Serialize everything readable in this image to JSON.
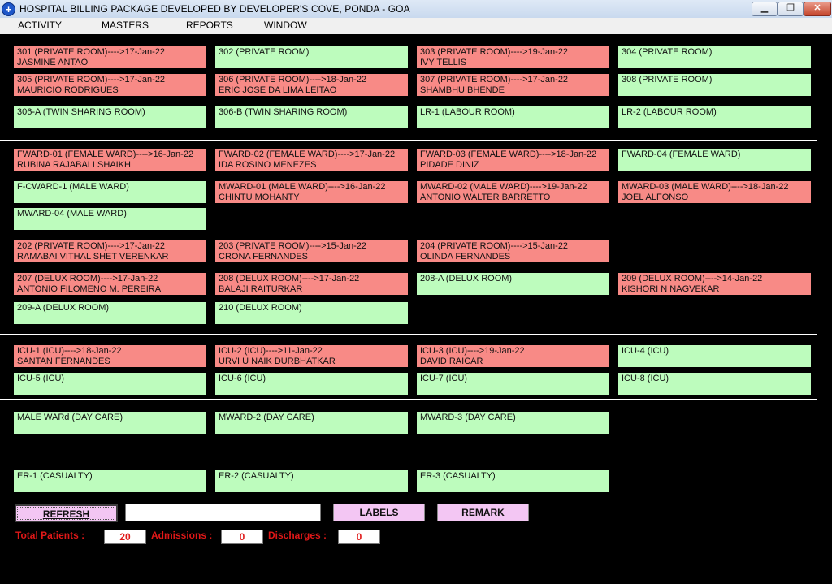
{
  "window": {
    "title": "HOSPITAL BILLING PACKAGE DEVELOPED BY DEVELOPER'S COVE, PONDA - GOA",
    "app_icon": "plus-icon",
    "controls": {
      "minimize": "▁",
      "restore": "❐",
      "close": "✕"
    }
  },
  "menu": [
    "ACTIVITY",
    "MASTERS",
    "REPORTS",
    "WINDOW"
  ],
  "colors": {
    "occupied": "#f88a86",
    "available": "#bdfcbd",
    "stat_text": "#e01818",
    "button": "#f3c6f3"
  },
  "beds": [
    {
      "l1": "301 (PRIVATE ROOM)---->17-Jan-22",
      "l2": "JASMINE ANTAO",
      "occ": true
    },
    {
      "l1": "302 (PRIVATE ROOM)",
      "l2": "",
      "occ": false
    },
    {
      "l1": "303 (PRIVATE ROOM)---->19-Jan-22",
      "l2": "IVY TELLIS",
      "occ": true
    },
    {
      "l1": "304 (PRIVATE ROOM)",
      "l2": "",
      "occ": false
    },
    {
      "l1": "305 (PRIVATE ROOM)---->17-Jan-22",
      "l2": "MAURICIO RODRIGUES",
      "occ": true
    },
    {
      "l1": "306 (PRIVATE ROOM)---->18-Jan-22",
      "l2": "ERIC JOSE DA LIMA LEITAO",
      "occ": true
    },
    {
      "l1": "307 (PRIVATE ROOM)---->17-Jan-22",
      "l2": "SHAMBHU BHENDE",
      "occ": true
    },
    {
      "l1": "308 (PRIVATE ROOM)",
      "l2": "",
      "occ": false
    },
    {
      "l1": "306-A (TWIN SHARING ROOM)",
      "l2": "",
      "occ": false
    },
    {
      "l1": "306-B (TWIN SHARING ROOM)",
      "l2": "",
      "occ": false
    },
    {
      "l1": "LR-1 (LABOUR ROOM)",
      "l2": "",
      "occ": false
    },
    {
      "l1": "LR-2 (LABOUR ROOM)",
      "l2": "",
      "occ": false
    },
    {
      "l1": "FWARD-01 (FEMALE WARD)---->16-Jan-22",
      "l2": "RUBINA RAJABALI SHAIKH",
      "occ": true
    },
    {
      "l1": "FWARD-02 (FEMALE WARD)---->17-Jan-22",
      "l2": "IDA ROSINO MENEZES",
      "occ": true
    },
    {
      "l1": "FWARD-03 (FEMALE WARD)---->18-Jan-22",
      "l2": "PIDADE DINIZ",
      "occ": true
    },
    {
      "l1": "FWARD-04 (FEMALE WARD)",
      "l2": "",
      "occ": false
    },
    {
      "l1": "F-CWARD-1  (MALE WARD)",
      "l2": "",
      "occ": false
    },
    {
      "l1": "MWARD-01 (MALE WARD)---->16-Jan-22",
      "l2": "CHINTU MOHANTY",
      "occ": true
    },
    {
      "l1": "MWARD-02 (MALE WARD)---->19-Jan-22",
      "l2": "ANTONIO WALTER BARRETTO",
      "occ": true
    },
    {
      "l1": "MWARD-03 (MALE WARD)---->18-Jan-22",
      "l2": "JOEL ALFONSO",
      "occ": true
    },
    {
      "l1": "MWARD-04 (MALE WARD)",
      "l2": "",
      "occ": false
    },
    {
      "l1": "202 (PRIVATE ROOM)---->17-Jan-22",
      "l2": "RAMABAI VITHAL SHET VERENKAR",
      "occ": true
    },
    {
      "l1": "203 (PRIVATE ROOM)---->15-Jan-22",
      "l2": "CRONA FERNANDES",
      "occ": true
    },
    {
      "l1": "204 (PRIVATE ROOM)---->15-Jan-22",
      "l2": "OLINDA FERNANDES",
      "occ": true
    },
    {
      "l1": "207 (DELUX ROOM)---->17-Jan-22",
      "l2": "ANTONIO FILOMENO M. PEREIRA",
      "occ": true
    },
    {
      "l1": "208 (DELUX ROOM)---->17-Jan-22",
      "l2": "BALAJI RAITURKAR",
      "occ": true
    },
    {
      "l1": "208-A (DELUX ROOM)",
      "l2": "",
      "occ": false
    },
    {
      "l1": "209 (DELUX ROOM)---->14-Jan-22",
      "l2": "KISHORI N NAGVEKAR",
      "occ": true
    },
    {
      "l1": "209-A (DELUX ROOM)",
      "l2": "",
      "occ": false
    },
    {
      "l1": "210 (DELUX ROOM)",
      "l2": "",
      "occ": false
    },
    {
      "l1": "ICU-1 (ICU)---->18-Jan-22",
      "l2": "SANTAN FERNANDES",
      "occ": true
    },
    {
      "l1": "ICU-2 (ICU)---->11-Jan-22",
      "l2": "URVI U NAIK DURBHATKAR",
      "occ": true
    },
    {
      "l1": "ICU-3 (ICU)---->19-Jan-22",
      "l2": "DAVID RAICAR",
      "occ": true
    },
    {
      "l1": "ICU-4 (ICU)",
      "l2": "",
      "occ": false
    },
    {
      "l1": "ICU-5 (ICU)",
      "l2": "",
      "occ": false
    },
    {
      "l1": "ICU-6 (ICU)",
      "l2": "",
      "occ": false
    },
    {
      "l1": "ICU-7 (ICU)",
      "l2": "",
      "occ": false
    },
    {
      "l1": "ICU-8 (ICU)",
      "l2": "",
      "occ": false
    },
    {
      "l1": "MALE WARd (DAY CARE)",
      "l2": "",
      "occ": false
    },
    {
      "l1": "MWARD-2 (DAY CARE)",
      "l2": "",
      "occ": false
    },
    {
      "l1": "MWARD-3 (DAY CARE)",
      "l2": "",
      "occ": false
    },
    {
      "l1": "ER-1 (CASUALTY)",
      "l2": "",
      "occ": false
    },
    {
      "l1": "ER-2 (CASUALTY)",
      "l2": "",
      "occ": false
    },
    {
      "l1": "ER-3 (CASUALTY)",
      "l2": "",
      "occ": false
    }
  ],
  "controls": {
    "refresh_label": "REFRESH",
    "labels_label": "LABELS",
    "remark_label": "REMARK",
    "search_value": ""
  },
  "stats": {
    "total_patients_label": "Total Patients :",
    "total_patients_value": "20",
    "admissions_label": "Admissions :",
    "admissions_value": "0",
    "discharges_label": "Discharges :",
    "discharges_value": "0"
  }
}
